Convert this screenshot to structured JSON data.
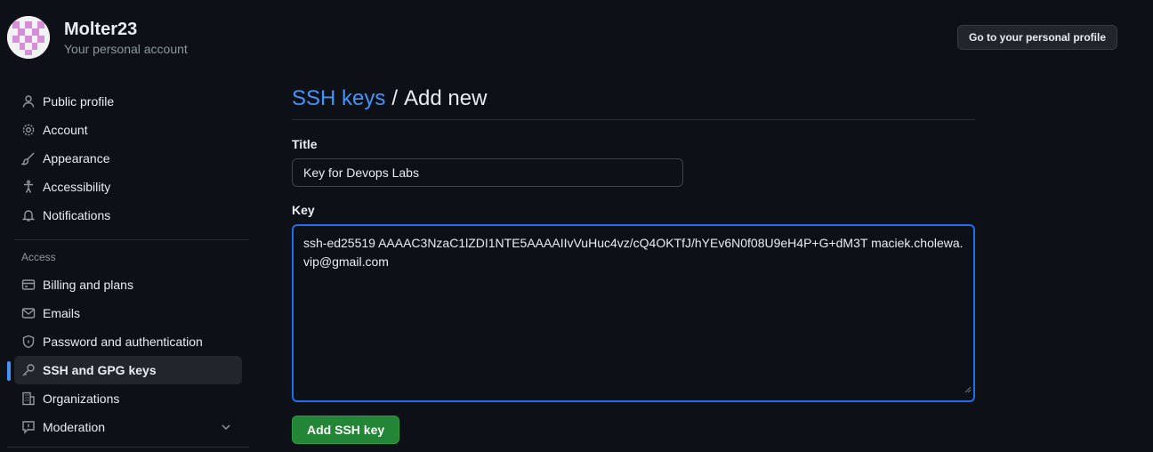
{
  "account": {
    "name": "Molter23",
    "subtitle": "Your personal account",
    "profile_button": "Go to your personal profile"
  },
  "sidebar": {
    "items": [
      {
        "label": "Public profile",
        "icon": "person-icon"
      },
      {
        "label": "Account",
        "icon": "gear-icon"
      },
      {
        "label": "Appearance",
        "icon": "paintbrush-icon"
      },
      {
        "label": "Accessibility",
        "icon": "accessibility-icon"
      },
      {
        "label": "Notifications",
        "icon": "bell-icon"
      }
    ],
    "access_label": "Access",
    "access_items": [
      {
        "label": "Billing and plans",
        "icon": "credit-card-icon"
      },
      {
        "label": "Emails",
        "icon": "mail-icon"
      },
      {
        "label": "Password and authentication",
        "icon": "shield-lock-icon"
      },
      {
        "label": "SSH and GPG keys",
        "icon": "key-icon",
        "active": true
      },
      {
        "label": "Organizations",
        "icon": "organization-icon"
      },
      {
        "label": "Moderation",
        "icon": "report-icon",
        "expandable": true
      }
    ]
  },
  "main": {
    "breadcrumb_link": "SSH keys",
    "breadcrumb_sep": "/",
    "breadcrumb_current": "Add new",
    "title_label": "Title",
    "title_value": "Key for Devops Labs",
    "key_label": "Key",
    "key_value": "ssh-ed25519 AAAAC3NzaC1lZDI1NTE5AAAAIIvVuHuc4vz/cQ4OKTfJ/hYEv6N0f08U9eH4P+G+dM3T maciek.cholewa.vip@gmail.com",
    "submit_label": "Add SSH key"
  },
  "colors": {
    "background": "#0d1117",
    "accent": "#4493f8",
    "button_green": "#238636",
    "focus_border": "#1f6feb"
  }
}
